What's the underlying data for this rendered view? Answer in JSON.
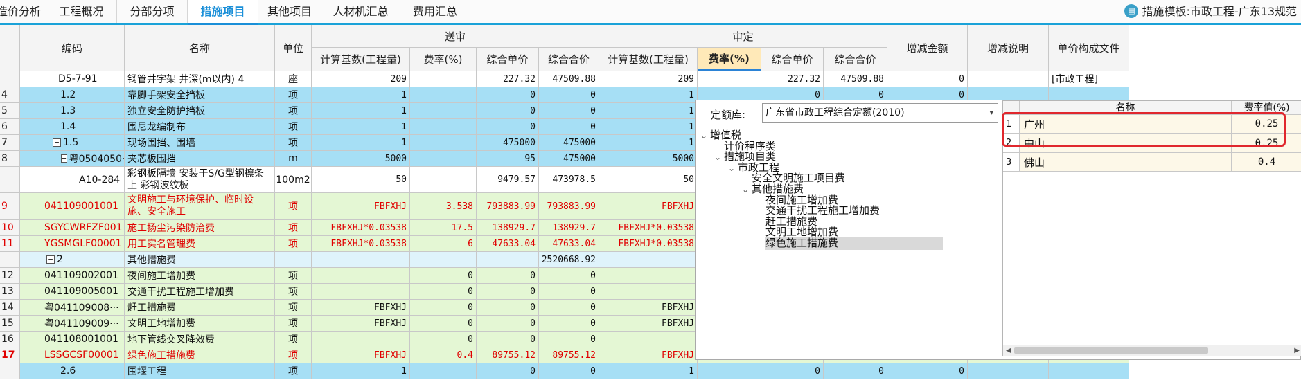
{
  "tabs": [
    {
      "label": "造价分析",
      "active": false
    },
    {
      "label": "工程概况",
      "active": false
    },
    {
      "label": "分部分项",
      "active": false
    },
    {
      "label": "措施项目",
      "active": true
    },
    {
      "label": "其他项目",
      "active": false
    },
    {
      "label": "人材机汇总",
      "active": false
    },
    {
      "label": "费用汇总",
      "active": false
    }
  ],
  "template_info": "措施模板:市政工程-广东13规范",
  "icons": {
    "template": "book-icon",
    "expand": "minus-icon",
    "tree_open": "chevron-down-icon",
    "select_arrow": "dropdown-arrow-icon"
  },
  "columns": {
    "code": "编码",
    "name": "名称",
    "unit": "单位",
    "submit_group": "送审",
    "review_group": "审定",
    "calc_base": "计算基数(工程量)",
    "rate": "费率(%)",
    "unit_price": "综合单价",
    "total_price": "综合合价",
    "review_calc_base": "计算基数(工程量)",
    "review_rate": "费率(%)",
    "review_unit_price": "综合单价",
    "review_total_price": "综合合价",
    "change_amount": "增减金额",
    "change_note": "增减说明",
    "price_file": "单价构成文件"
  },
  "rows": [
    {
      "rn": "",
      "code": "D5-7-91",
      "name": "钢管井字架 井深(m以内) 4",
      "unit": "座",
      "base": "209",
      "rate": "",
      "uprice": "227.32",
      "total": "47509.88",
      "rbase": "209",
      "rrate": "",
      "ruprice": "227.32",
      "rtotal": "47509.88",
      "chg": "0",
      "note": "",
      "file": "[市政工程]",
      "style": "white"
    },
    {
      "rn": "4",
      "code": "1.2",
      "name": "靠脚手架安全挡板",
      "unit": "项",
      "base": "1",
      "rate": "",
      "uprice": "0",
      "total": "0",
      "rbase": "1",
      "rrate": "",
      "ruprice": "0",
      "rtotal": "0",
      "chg": "0",
      "note": "",
      "file": "",
      "style": "blue"
    },
    {
      "rn": "5",
      "code": "1.3",
      "name": "独立安全防护挡板",
      "unit": "项",
      "base": "1",
      "rate": "",
      "uprice": "0",
      "total": "0",
      "rbase": "1",
      "style": "blue"
    },
    {
      "rn": "6",
      "code": "1.4",
      "name": "围尼龙编制布",
      "unit": "项",
      "base": "1",
      "rate": "",
      "uprice": "0",
      "total": "0",
      "rbase": "1",
      "style": "blue"
    },
    {
      "rn": "7",
      "code": "1.5",
      "name": "现场围挡、围墙",
      "unit": "项",
      "base": "1",
      "rate": "",
      "uprice": "475000",
      "total": "475000",
      "rbase": "1",
      "style": "blue"
    },
    {
      "rn": "8",
      "code": "粤0504050···",
      "name": "夹芯板围挡",
      "unit": "m",
      "base": "5000",
      "rate": "",
      "uprice": "95",
      "total": "475000",
      "rbase": "5000",
      "style": "blue"
    },
    {
      "rn": "",
      "code": "A10-284",
      "name": "彩钢板隔墙 安装于S/G型钢檩条上 彩钢波纹板",
      "unit": "100m2",
      "base": "50",
      "rate": "",
      "uprice": "9479.57",
      "total": "473978.5",
      "rbase": "50",
      "style": "white"
    },
    {
      "rn": "9",
      "code": "041109001001",
      "name": "文明施工与环境保护、临时设施、安全施工",
      "unit": "项",
      "base": "FBFXHJ",
      "rate": "3.538",
      "uprice": "793883.99",
      "total": "793883.99",
      "rbase": "FBFXHJ",
      "style": "green",
      "red": true
    },
    {
      "rn": "10",
      "code": "SGYCWRFZF001",
      "name": "施工扬尘污染防治费",
      "unit": "项",
      "base": "FBFXHJ*0.03538",
      "rate": "17.5",
      "uprice": "138929.7",
      "total": "138929.7",
      "rbase": "FBFXHJ*0.03538",
      "style": "green",
      "red": true
    },
    {
      "rn": "11",
      "code": "YGSMGLF00001",
      "name": "用工实名管理费",
      "unit": "项",
      "base": "FBFXHJ*0.03538",
      "rate": "6",
      "uprice": "47633.04",
      "total": "47633.04",
      "rbase": "FBFXHJ*0.03538",
      "style": "green",
      "red": true
    },
    {
      "rn": "",
      "code": "2",
      "name": "其他措施费",
      "unit": "",
      "base": "",
      "rate": "",
      "uprice": "",
      "total": "2520668.92",
      "rbase": "",
      "style": "lightblue"
    },
    {
      "rn": "12",
      "code": "041109002001",
      "name": "夜间施工增加费",
      "unit": "项",
      "base": "",
      "rate": "0",
      "uprice": "0",
      "total": "0",
      "rbase": "",
      "style": "green"
    },
    {
      "rn": "13",
      "code": "041109005001",
      "name": "交通干扰工程施工增加费",
      "unit": "项",
      "base": "",
      "rate": "0",
      "uprice": "0",
      "total": "0",
      "rbase": "",
      "style": "green"
    },
    {
      "rn": "14",
      "code": "粤041109008···",
      "name": "赶工措施费",
      "unit": "项",
      "base": "FBFXHJ",
      "rate": "0",
      "uprice": "0",
      "total": "0",
      "rbase": "FBFXHJ",
      "style": "green"
    },
    {
      "rn": "15",
      "code": "粤041109009···",
      "name": "文明工地增加费",
      "unit": "项",
      "base": "FBFXHJ",
      "rate": "0",
      "uprice": "0",
      "total": "0",
      "rbase": "FBFXHJ",
      "style": "green"
    },
    {
      "rn": "16",
      "code": "041108001001",
      "name": "地下管线交叉降效费",
      "unit": "项",
      "base": "",
      "rate": "0",
      "uprice": "0",
      "total": "0",
      "rbase": "",
      "style": "green"
    },
    {
      "rn": "17",
      "code": "LSSGCSF00001",
      "name": "绿色施工措施费",
      "unit": "项",
      "base": "FBFXHJ",
      "rate": "0.4",
      "uprice": "89755.12",
      "total": "89755.12",
      "rbase": "FBFXHJ",
      "style": "green",
      "red": true,
      "current": true
    },
    {
      "rn": "",
      "code": "2.6",
      "name": "围堰工程",
      "unit": "项",
      "base": "1",
      "rate": "",
      "uprice": "0",
      "total": "0",
      "rbase": "1",
      "rrate": "",
      "ruprice": "0",
      "rtotal": "0",
      "chg": "0",
      "note": "",
      "file": "",
      "style": "blue"
    }
  ],
  "panel": {
    "lib_label": "定额库:",
    "lib_value": "广东省市政工程综合定额(2010)",
    "tree": [
      "增值税",
      "计价程序类",
      "措施项目类",
      "市政工程",
      "安全文明施工项目费",
      "其他措施费",
      "夜间施工增加费",
      "交通干扰工程施工增加费",
      "赶工措施费",
      "文明工地增加费",
      "绿色施工措施费"
    ],
    "rate_table": {
      "name_header": "名称",
      "value_header": "费率值(%)",
      "rows": [
        {
          "idx": "1",
          "name": "广州",
          "value": "0.25"
        },
        {
          "idx": "2",
          "name": "中山",
          "value": "0.25"
        },
        {
          "idx": "3",
          "name": "佛山",
          "value": "0.4"
        }
      ]
    }
  }
}
